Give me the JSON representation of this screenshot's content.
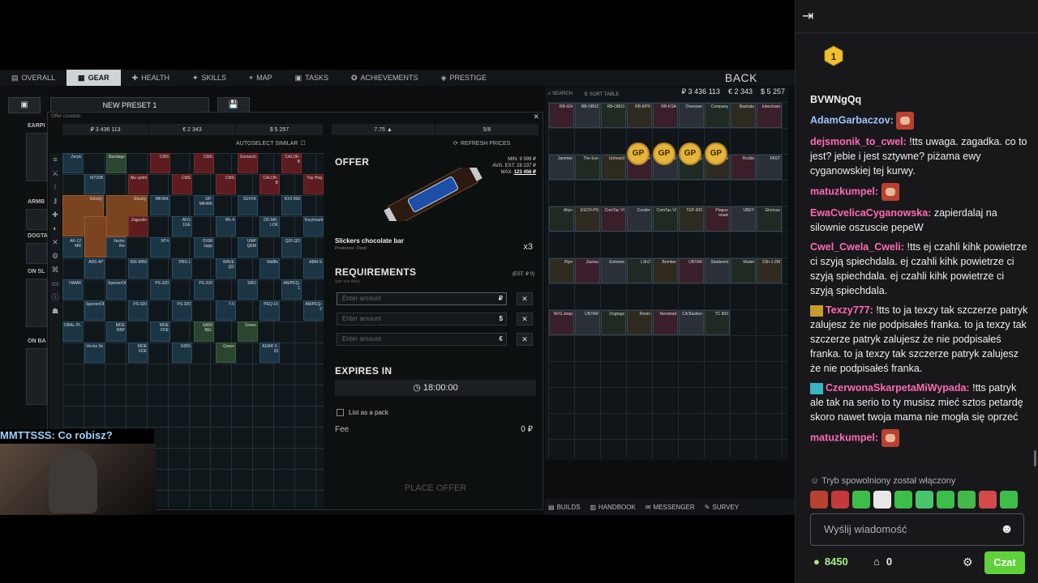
{
  "game": {
    "tabs": [
      {
        "label": "OVERALL",
        "icon": "overall-icon"
      },
      {
        "label": "GEAR",
        "icon": "gear-icon"
      },
      {
        "label": "HEALTH",
        "icon": "health-icon"
      },
      {
        "label": "SKILLS",
        "icon": "skills-icon"
      },
      {
        "label": "MAP",
        "icon": "map-pin-icon"
      },
      {
        "label": "TASKS",
        "icon": "tasks-icon"
      },
      {
        "label": "ACHIEVEMENTS",
        "icon": "achievement-icon"
      },
      {
        "label": "PRESTIGE",
        "icon": "prestige-icon"
      }
    ],
    "back_label": "BACK",
    "preset_name": "NEW PRESET 1",
    "left_labels": [
      "EARPI",
      "ARMB",
      "DOGTA",
      "ON SL",
      "ON BA"
    ],
    "dialog": {
      "title": "Offer creation",
      "stats": [
        "₽ 3 436 113",
        "€ 2 343",
        "$ 5 257",
        "7.75 ▲",
        "5/6"
      ],
      "autoselect_label": "AUTOSELECT SIMILAR",
      "refresh_label": "REFRESH PRICES",
      "offer": {
        "heading": "OFFER",
        "min_label": "MIN.",
        "min_value": "9 999 ₽",
        "avg_label": "AVG. EST.",
        "avg_value": "28 237 ₽",
        "max_label": "MAX.",
        "max_value": "123 456 ₽",
        "item_name": "Slickers chocolate bar",
        "item_category": "Provisions › Food",
        "quantity": "x3",
        "requirements_heading": "REQUIREMENTS",
        "requirements_sub": "(per one item)",
        "est_label": "(EST. ₽ 0)",
        "fields": [
          {
            "placeholder": "Enter amount",
            "currency": "₽"
          },
          {
            "placeholder": "Enter amount",
            "currency": "$"
          },
          {
            "placeholder": "Enter amount",
            "currency": "€"
          }
        ],
        "expires_heading": "EXPIRES IN",
        "timer": "18:00:00",
        "pack_label": "List as a pack",
        "fee_label": "Fee",
        "fee_value": "0 ₽",
        "place_label": "PLACE OFFER"
      },
      "inventory_items": [
        {
          "label": "Zeryk",
          "color": "blue"
        },
        {
          "label": "M720B",
          "color": "blue"
        },
        {
          "label": "Bandage",
          "color": "green"
        },
        {
          "label": "Alu splint",
          "color": "red"
        },
        {
          "label": "CMS",
          "color": "red"
        },
        {
          "label": "CMS",
          "color": "red"
        },
        {
          "label": "CMS",
          "color": "red"
        },
        {
          "label": "CMS",
          "color": "red"
        },
        {
          "label": "Esmarch",
          "color": "red"
        },
        {
          "label": "CALOK-B",
          "color": "red"
        },
        {
          "label": "CALOK-B",
          "color": "red"
        },
        {
          "label": "Top Hog",
          "color": "red"
        },
        {
          "label": "Grizzly",
          "color": "orange"
        },
        {
          "label": "Grizzly",
          "color": "orange"
        },
        {
          "label": "Grizzly",
          "color": "orange"
        },
        {
          "label": "Zagustin",
          "color": "red"
        },
        {
          "label": "MK46K",
          "color": "blue"
        },
        {
          "label": "AFG 1GE",
          "color": "blue"
        },
        {
          "label": "GP-MK46K",
          "color": "blue"
        },
        {
          "label": "RK-4",
          "color": "blue"
        },
        {
          "label": "SSVFK",
          "color": "blue"
        },
        {
          "label": "DD MK-LOK",
          "color": "blue"
        },
        {
          "label": "KX3 556",
          "color": "blue"
        },
        {
          "label": "Keymount",
          "color": "blue"
        },
        {
          "label": "AK-12 MR",
          "color": "blue"
        },
        {
          "label": "ARS 4P",
          "color": "blue"
        },
        {
          "label": "Vector the",
          "color": "blue"
        },
        {
          "label": "556-MINI",
          "color": "blue"
        },
        {
          "label": "NT4",
          "color": "blue"
        },
        {
          "label": "PBS-1",
          "color": "blue"
        },
        {
          "label": "SV98 supp",
          "color": "blue"
        },
        {
          "label": "WAVE QD",
          "color": "blue"
        },
        {
          "label": "UMP QEM",
          "color": "blue"
        },
        {
          "label": "Waffle",
          "color": "blue"
        },
        {
          "label": "Q20 QD",
          "color": "blue"
        },
        {
          "label": "ABM-S",
          "color": "blue"
        },
        {
          "label": "HAMR",
          "color": "blue"
        },
        {
          "label": "SpecterDR",
          "color": "blue"
        },
        {
          "label": "SpecterDR",
          "color": "blue"
        },
        {
          "label": "PS-320",
          "color": "blue"
        },
        {
          "label": "PS-320",
          "color": "blue"
        },
        {
          "label": "PS-320",
          "color": "blue"
        },
        {
          "label": "PS-320",
          "color": "blue"
        },
        {
          "label": "T-5",
          "color": "blue"
        },
        {
          "label": "SRO",
          "color": "blue"
        },
        {
          "label": "PEQ-15",
          "color": "blue"
        },
        {
          "label": "AN/PEQ-1",
          "color": "blue"
        },
        {
          "label": "AN/PEQ-2",
          "color": "blue"
        },
        {
          "label": "DBAL-PL",
          "color": "blue"
        },
        {
          "label": "Vector 9x",
          "color": "blue"
        },
        {
          "label": "MOE RBP",
          "color": "blue"
        },
        {
          "label": "MOE FDE",
          "color": "blue"
        },
        {
          "label": "MOE FDE",
          "color": "blue"
        },
        {
          "label": "G055",
          "color": "blue"
        },
        {
          "label": "SA58 BEL",
          "color": "green"
        },
        {
          "label": "Green",
          "color": "green"
        },
        {
          "label": "Green",
          "color": "green"
        },
        {
          "label": "ADAR 2-15",
          "color": "blue"
        }
      ]
    },
    "stash": {
      "search_label": "SEARCH",
      "sort_label": "SORT TABLE",
      "money": [
        "₽ 3 436 113",
        "€ 2 343",
        "$ 5 257"
      ],
      "item_labels": [
        "RB-GN",
        "RB-OB02",
        "RB-OB03",
        "RB-KPN",
        "RB-KSA",
        "Overseer",
        "Company",
        "Bashala",
        "Intercham",
        "Jammer",
        "The Eye",
        "Unheard",
        "Tripwire",
        "Tripwire",
        "Johnny",
        "Bobs",
        "Rodds",
        "FAST",
        "Altyn",
        "ESCH-PS",
        "ComTac VI",
        "Condor",
        "ComTac VI",
        "TEP-300",
        "Plague mask",
        "UBEY",
        "Glorious",
        "Pipe",
        "Zaetsa",
        "Extreme",
        "LShZ",
        "Bomber",
        "UNTAR",
        "Shattered",
        "Wallet",
        "ZSh-1-2M",
        "NVG strap",
        "UNTAR",
        "Dogtags",
        "Ronin",
        "Neostrad",
        "CA Bastion",
        "TC 800"
      ],
      "gp_label": "GP",
      "counters": [
        "99",
        "60",
        "3",
        "34"
      ]
    },
    "bottom": [
      {
        "label": "BUILDS",
        "icon": "builds-icon"
      },
      {
        "label": "HANDBOOK",
        "icon": "handbook-icon"
      },
      {
        "label": "MESSENGER",
        "icon": "messenger-icon"
      },
      {
        "label": "SURVEY",
        "icon": "survey-icon"
      }
    ]
  },
  "overlay": {
    "viewer_line": "MMTTSSS: Co robisz?"
  },
  "chat": {
    "messages": [
      {
        "user": "BVWNgQq",
        "color": "#efeff1",
        "text": "",
        "user_only": true
      },
      {
        "user": "AdamGarbaczov:",
        "color": "#a0c4ff",
        "text": "",
        "emote": true
      },
      {
        "user": "dejsmonik_to_cwel:",
        "color": "#ff69b4",
        "text": "!tts uwaga. zagadka. co to jest? jebie i jest sztywne? piżama ewy cyganowskiej tej kurwy."
      },
      {
        "user": "matuzkumpel:",
        "color": "#ff69b4",
        "text": "",
        "emote": true
      },
      {
        "user": "EwaCvelicaCyganowska:",
        "color": "#ff69b4",
        "text": "zapierdalaj na silownie oszuscie pepeW"
      },
      {
        "user": "Cwel_Cwela_Cweli:",
        "color": "#ff69b4",
        "text": "!tts ej czahli kihk powietrze ci szyją spiechdala. ej czahli kihk powietrze ci szyją spiechdala. ej czahli kihk powietrze ci szyją spiechdala."
      },
      {
        "user": "Texzy777:",
        "color": "#ff69b4",
        "text": "!tts to ja texzy tak szczerze patryk zalujesz że nie podpisałeś franka. to ja texzy tak szczerze patryk zalujesz że nie podpisałeś franka. to ja texzy tak szczerze patryk zalujesz że nie podpisałeś franka.",
        "badge": "crown"
      },
      {
        "user": "CzerwonaSkarpetaMiWypada:",
        "color": "#ff69b4",
        "text": "!tts patryk ale tak na serio to ty musisz mieć sztos petardę skoro nawet twoja mama nie mogła się oprzeć",
        "badge": "sub"
      },
      {
        "user": "matuzkumpel:",
        "color": "#ff69b4",
        "text": "",
        "emote": true
      }
    ],
    "slow_mode": "Tryb spowolniony został włączony",
    "input_placeholder": "Wyślij wiadomość",
    "points": "8450",
    "drops": "0",
    "chat_button": "Czat",
    "prediction_value": "1"
  }
}
